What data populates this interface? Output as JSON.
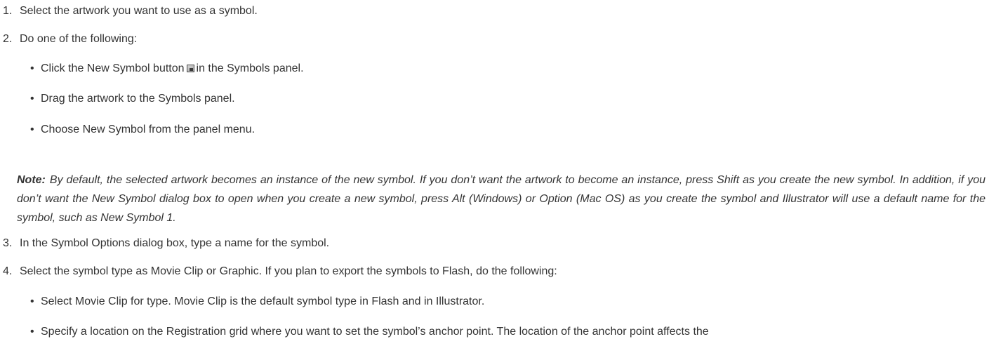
{
  "steps": {
    "s1": {
      "num": "1.",
      "text": "Select the artwork you want to use as a symbol."
    },
    "s2": {
      "num": "2.",
      "text": "Do one of the following:"
    },
    "s3": {
      "num": "3.",
      "text": "In the Symbol Options dialog box, type a name for the symbol."
    },
    "s4": {
      "num": "4.",
      "text": "Select the symbol type as Movie Clip or Graphic. If you plan to export the symbols to Flash, do the following:"
    }
  },
  "step2_bullets": {
    "b1_before": "Click the New Symbol button",
    "b1_after": "in the Symbols panel.",
    "b2": "Drag the artwork to the Symbols panel.",
    "b3": "Choose New Symbol from the panel menu."
  },
  "note": {
    "label": "Note:",
    "text": "By default, the selected artwork becomes an instance of the new symbol. If you don’t want the artwork to become an instance, press Shift as you create the new symbol. In addition, if you don’t want the New Symbol dialog box to open when you create a new symbol, press Alt (Windows) or Option (Mac OS) as you create the symbol and Illustrator will use a default name for the symbol, such as New Symbol 1."
  },
  "step4_bullets": {
    "b1": "Select Movie Clip for type. Movie Clip is the default symbol type in Flash and in Illustrator.",
    "b2": "Specify a location on the Registration grid where you want to set the symbol’s anchor point. The location of the anchor point affects the"
  },
  "bullet_char": "•",
  "icons": {
    "new_symbol": "new-symbol-icon"
  }
}
